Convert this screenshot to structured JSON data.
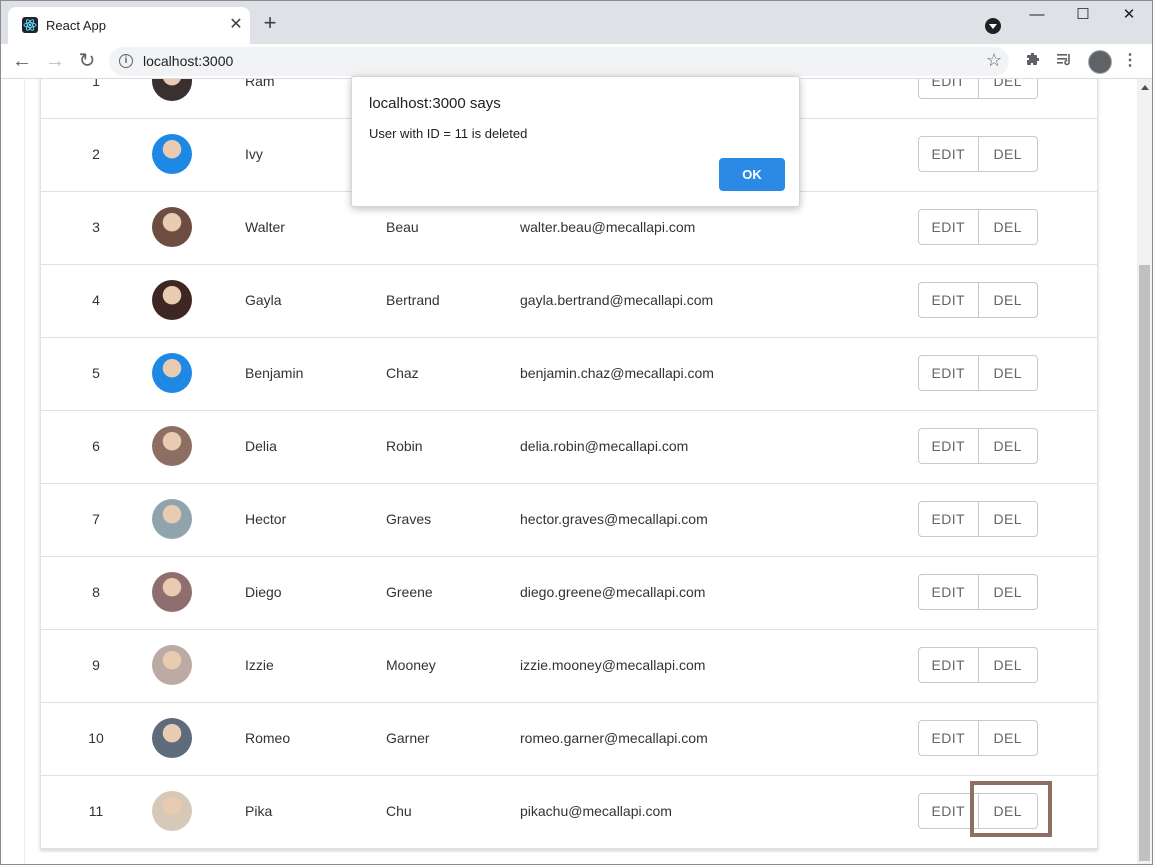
{
  "browser": {
    "tab_title": "React App",
    "tab_close": "✕",
    "new_tab": "+",
    "url": "localhost:3000",
    "icons": [
      "react-favicon",
      "profile-dropdown-icon",
      "extensions-icon",
      "reading-list-icon",
      "profile-avatar",
      "menu-icon"
    ]
  },
  "window_controls": {
    "minimize": "—",
    "maximize": "☐",
    "close": "✕"
  },
  "nav": {
    "back": "←",
    "forward": "→",
    "reload": "↻",
    "info": "i",
    "star": "☆"
  },
  "table": {
    "rows": [
      {
        "id": "1",
        "first": "Ram",
        "last": "",
        "email": "",
        "avatar_color": "#3a3030"
      },
      {
        "id": "2",
        "first": "Ivy",
        "last": "",
        "email": "",
        "avatar_color": "#1e88e5"
      },
      {
        "id": "3",
        "first": "Walter",
        "last": "Beau",
        "email": "walter.beau@mecallapi.com",
        "avatar_color": "#6d4c41"
      },
      {
        "id": "4",
        "first": "Gayla",
        "last": "Bertrand",
        "email": "gayla.bertrand@mecallapi.com",
        "avatar_color": "#3e2723"
      },
      {
        "id": "5",
        "first": "Benjamin",
        "last": "Chaz",
        "email": "benjamin.chaz@mecallapi.com",
        "avatar_color": "#1e88e5"
      },
      {
        "id": "6",
        "first": "Delia",
        "last": "Robin",
        "email": "delia.robin@mecallapi.com",
        "avatar_color": "#8d6e63"
      },
      {
        "id": "7",
        "first": "Hector",
        "last": "Graves",
        "email": "hector.graves@mecallapi.com",
        "avatar_color": "#90a4ae"
      },
      {
        "id": "8",
        "first": "Diego",
        "last": "Greene",
        "email": "diego.greene@mecallapi.com",
        "avatar_color": "#8e6e6e"
      },
      {
        "id": "9",
        "first": "Izzie",
        "last": "Mooney",
        "email": "izzie.mooney@mecallapi.com",
        "avatar_color": "#bcaaa4"
      },
      {
        "id": "10",
        "first": "Romeo",
        "last": "Garner",
        "email": "romeo.garner@mecallapi.com",
        "avatar_color": "#5d6b7a"
      },
      {
        "id": "11",
        "first": "Pika",
        "last": "Chu",
        "email": "pikachu@mecallapi.com",
        "avatar_color": "#d7c9b8"
      }
    ],
    "edit_label": "EDIT",
    "del_label": "DEL"
  },
  "dialog": {
    "title": "localhost:3000 says",
    "message": "User with ID = 11 is deleted",
    "ok_label": "OK"
  },
  "colors": {
    "dialog_ok": "#2b8ae6",
    "highlight": "#8e6f63"
  }
}
